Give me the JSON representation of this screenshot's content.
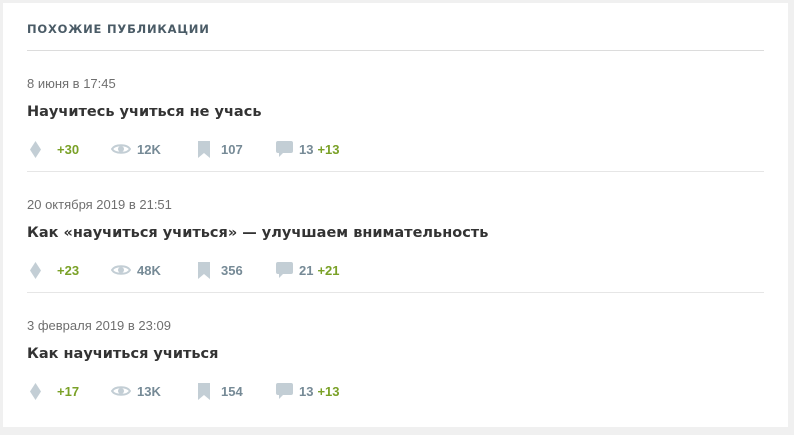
{
  "section": {
    "title": "ПОХОЖИЕ ПУБЛИКАЦИИ"
  },
  "publications": [
    {
      "date": "8 июня в 17:45",
      "title": "Научитесь учиться не учась",
      "votes": "+30",
      "views": "12K",
      "bookmarks": "107",
      "comments": "13",
      "new_comments": "+13"
    },
    {
      "date": "20 октября 2019 в 21:51",
      "title": "Как «научиться учиться» — улучшаем внимательность",
      "votes": "+23",
      "views": "48K",
      "bookmarks": "356",
      "comments": "21",
      "new_comments": "+21"
    },
    {
      "date": "3 февраля 2019 в 23:09",
      "title": "Как научиться учиться",
      "votes": "+17",
      "views": "13K",
      "bookmarks": "154",
      "comments": "13",
      "new_comments": "+13"
    }
  ],
  "icons": {
    "votes": "rating-icon",
    "views": "eye-icon",
    "bookmarks": "bookmark-icon",
    "comments": "comment-icon"
  },
  "colors": {
    "positive": "#7aa127",
    "stat_text": "#768a96",
    "icon": "#c3ced5"
  }
}
